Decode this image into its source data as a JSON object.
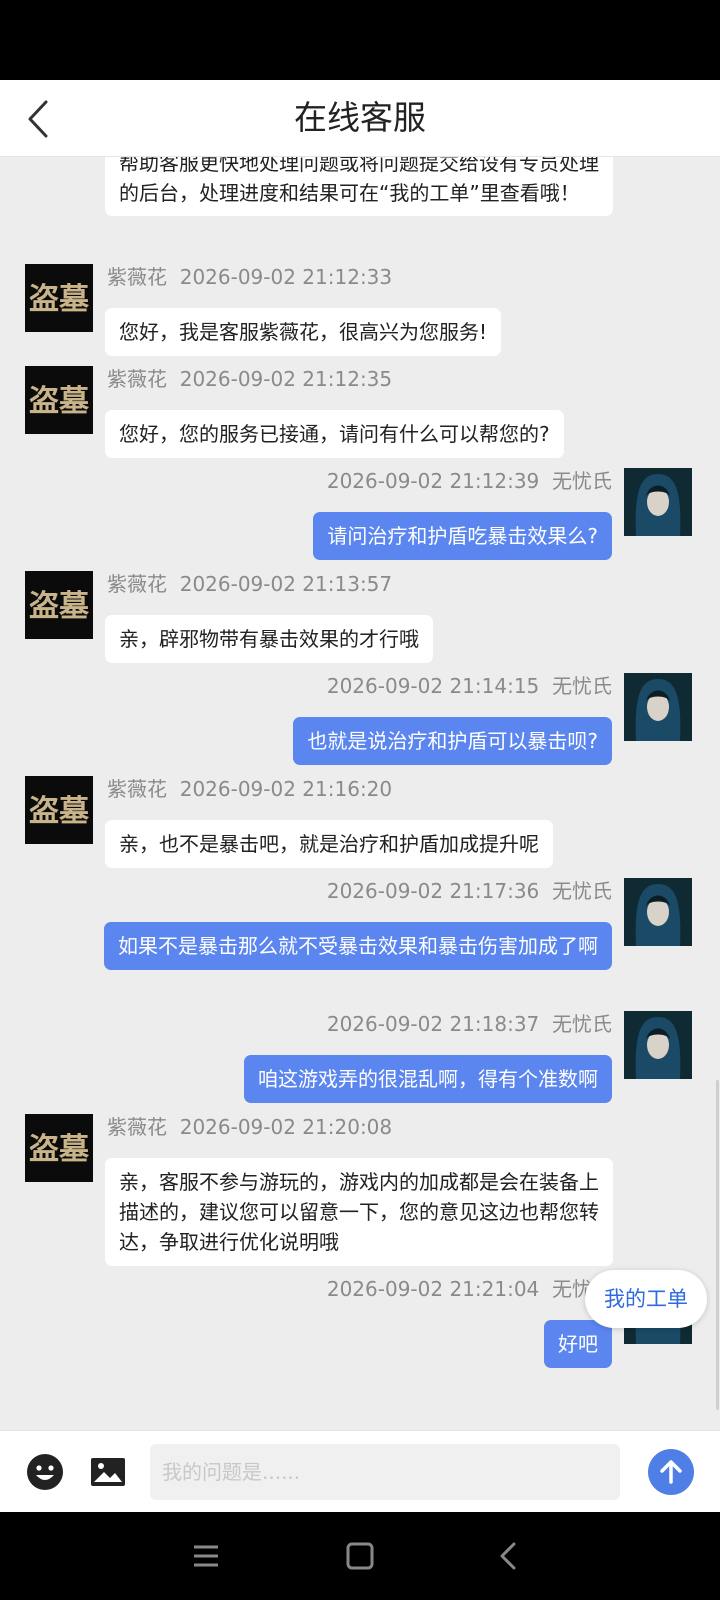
{
  "header": {
    "title": "在线客服"
  },
  "intro_text": "帮助客服更快地处理问题或将问题提交给设有专员处理的后台，处理进度和结果可在“我的工单”里查看哦！",
  "messages": [
    {
      "sender": "agent",
      "name": "紫薇花",
      "time": "2026-09-02 21:12:33",
      "text": "您好，我是客服紫薇花，很高兴为您服务!"
    },
    {
      "sender": "agent",
      "name": "紫薇花",
      "time": "2026-09-02 21:12:35",
      "text": "您好，您的服务已接通，请问有什么可以帮您的?"
    },
    {
      "sender": "user",
      "name": "无忧氏",
      "time": "2026-09-02 21:12:39",
      "text": "请问治疗和护盾吃暴击效果么?"
    },
    {
      "sender": "agent",
      "name": "紫薇花",
      "time": "2026-09-02 21:13:57",
      "text": "亲，辟邪物带有暴击效果的才行哦"
    },
    {
      "sender": "user",
      "name": "无忧氏",
      "time": "2026-09-02 21:14:15",
      "text": "也就是说治疗和护盾可以暴击呗?"
    },
    {
      "sender": "agent",
      "name": "紫薇花",
      "time": "2026-09-02 21:16:20",
      "text": "亲，也不是暴击吧，就是治疗和护盾加成提升呢"
    },
    {
      "sender": "user",
      "name": "无忧氏",
      "time": "2026-09-02 21:17:36",
      "text": "如果不是暴击那么就不受暴击效果和暴击伤害加成了啊"
    },
    {
      "sender": "user",
      "name": "无忧氏",
      "time": "2026-09-02 21:18:37",
      "text": "咱这游戏弄的很混乱啊，得有个准数啊"
    },
    {
      "sender": "agent",
      "name": "紫薇花",
      "time": "2026-09-02 21:20:08",
      "text": "亲，客服不参与游玩的，游戏内的加成都是会在装备上描述的，建议您可以留意一下，您的意见这边也帮您转达，争取进行优化说明哦"
    },
    {
      "sender": "user",
      "name": "无忧氏",
      "time": "2026-09-02 21:21:04",
      "text": "好吧"
    }
  ],
  "agent_avatar_text": "盗墓",
  "ticket_button": "我的工单",
  "input": {
    "placeholder": "我的问题是......",
    "value": ""
  },
  "colors": {
    "user_bubble": "#5b86f0",
    "agent_bubble": "#ffffff",
    "chat_bg": "#ededed",
    "accent": "#4f7fe6"
  },
  "icons": {
    "back": "chevron-left-icon",
    "emoji": "smiley-icon",
    "image": "image-icon",
    "send": "arrow-up-icon"
  }
}
